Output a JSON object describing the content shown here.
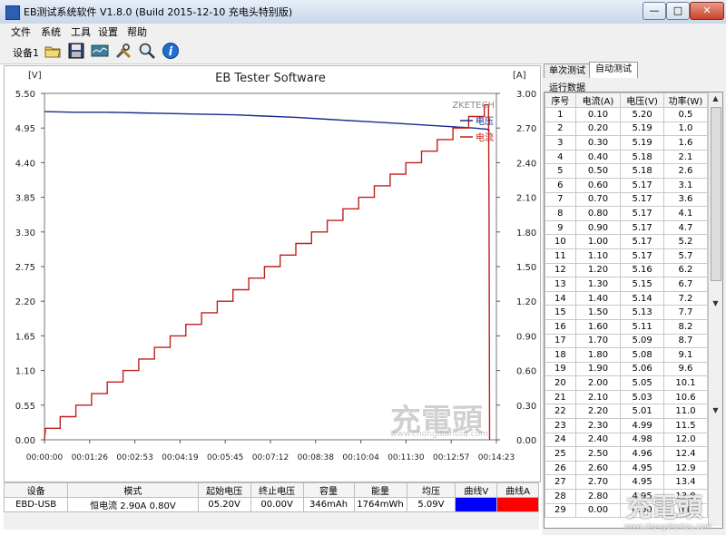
{
  "window": {
    "title": "EB测试系统软件 V1.8.0 (Build 2015-12-10 充电头特别版)",
    "minimize": "—",
    "maximize": "□",
    "close": "✕"
  },
  "menu": [
    "文件",
    "系统",
    "工具",
    "设置",
    "帮助"
  ],
  "toolbar": {
    "device_label": "设备1",
    "icons": [
      "open-folder-icon",
      "save-disk-icon",
      "waveform-icon",
      "tools-icon",
      "zoom-icon",
      "info-icon"
    ]
  },
  "chart_data": {
    "type": "line",
    "title": "EB Tester Software",
    "brand": "ZKETECH",
    "left_unit": "[V]",
    "right_unit": "[A]",
    "y_left_ticks": [
      "5.50",
      "4.95",
      "4.40",
      "3.85",
      "3.30",
      "2.75",
      "2.20",
      "1.65",
      "1.10",
      "0.55",
      "0.00"
    ],
    "y_right_ticks": [
      "3.00",
      "2.70",
      "2.40",
      "2.10",
      "1.80",
      "1.50",
      "1.20",
      "0.90",
      "0.60",
      "0.30",
      "0.00"
    ],
    "x_ticks": [
      "00:00:00",
      "00:01:26",
      "00:02:53",
      "00:04:19",
      "00:05:45",
      "00:07:12",
      "00:08:38",
      "00:10:04",
      "00:11:30",
      "00:12:57",
      "00:14:23"
    ],
    "ylim_left": [
      0,
      5.5
    ],
    "ylim_right": [
      0,
      3.0
    ],
    "x_range_seconds": [
      0,
      863
    ],
    "grid": true,
    "legend": "top-right",
    "series": [
      {
        "name": "电压",
        "axis": "left",
        "color": "#1a2a8c",
        "points": [
          [
            0,
            5.21
          ],
          [
            60,
            5.2
          ],
          [
            120,
            5.2
          ],
          [
            180,
            5.19
          ],
          [
            240,
            5.18
          ],
          [
            300,
            5.17
          ],
          [
            360,
            5.16
          ],
          [
            420,
            5.14
          ],
          [
            480,
            5.12
          ],
          [
            540,
            5.09
          ],
          [
            600,
            5.06
          ],
          [
            660,
            5.03
          ],
          [
            720,
            5.0
          ],
          [
            780,
            4.97
          ],
          [
            820,
            4.95
          ],
          [
            846,
            4.93
          ],
          [
            850,
            4.9
          ]
        ]
      },
      {
        "name": "电流",
        "axis": "right",
        "color": "#c0201a",
        "points": [
          [
            0,
            0.0
          ],
          [
            2,
            0.1
          ],
          [
            30,
            0.1
          ],
          [
            30,
            0.2
          ],
          [
            60,
            0.2
          ],
          [
            60,
            0.3
          ],
          [
            90,
            0.3
          ],
          [
            90,
            0.4
          ],
          [
            120,
            0.4
          ],
          [
            120,
            0.5
          ],
          [
            150,
            0.5
          ],
          [
            150,
            0.6
          ],
          [
            180,
            0.6
          ],
          [
            180,
            0.7
          ],
          [
            210,
            0.7
          ],
          [
            210,
            0.8
          ],
          [
            240,
            0.8
          ],
          [
            240,
            0.9
          ],
          [
            270,
            0.9
          ],
          [
            270,
            1.0
          ],
          [
            300,
            1.0
          ],
          [
            300,
            1.1
          ],
          [
            330,
            1.1
          ],
          [
            330,
            1.2
          ],
          [
            360,
            1.2
          ],
          [
            360,
            1.3
          ],
          [
            390,
            1.3
          ],
          [
            390,
            1.4
          ],
          [
            420,
            1.4
          ],
          [
            420,
            1.5
          ],
          [
            450,
            1.5
          ],
          [
            450,
            1.6
          ],
          [
            480,
            1.6
          ],
          [
            480,
            1.7
          ],
          [
            510,
            1.7
          ],
          [
            510,
            1.8
          ],
          [
            540,
            1.8
          ],
          [
            540,
            1.9
          ],
          [
            570,
            1.9
          ],
          [
            570,
            2.0
          ],
          [
            600,
            2.0
          ],
          [
            600,
            2.1
          ],
          [
            630,
            2.1
          ],
          [
            630,
            2.2
          ],
          [
            660,
            2.2
          ],
          [
            660,
            2.3
          ],
          [
            690,
            2.3
          ],
          [
            690,
            2.4
          ],
          [
            720,
            2.4
          ],
          [
            720,
            2.5
          ],
          [
            750,
            2.5
          ],
          [
            750,
            2.6
          ],
          [
            780,
            2.6
          ],
          [
            780,
            2.7
          ],
          [
            810,
            2.7
          ],
          [
            810,
            2.8
          ],
          [
            840,
            2.8
          ],
          [
            840,
            2.9
          ],
          [
            848,
            2.9
          ],
          [
            849,
            2.0
          ],
          [
            850,
            0.0
          ]
        ]
      }
    ]
  },
  "right_panel": {
    "tabs": [
      "单次测试",
      "自动测试"
    ],
    "active_tab": 1,
    "group_label": "运行数据",
    "columns": [
      "序号",
      "电流(A)",
      "电压(V)",
      "功率(W)"
    ],
    "rows": [
      [
        "1",
        "0.10",
        "5.20",
        "0.5"
      ],
      [
        "2",
        "0.20",
        "5.19",
        "1.0"
      ],
      [
        "3",
        "0.30",
        "5.19",
        "1.6"
      ],
      [
        "4",
        "0.40",
        "5.18",
        "2.1"
      ],
      [
        "5",
        "0.50",
        "5.18",
        "2.6"
      ],
      [
        "6",
        "0.60",
        "5.17",
        "3.1"
      ],
      [
        "7",
        "0.70",
        "5.17",
        "3.6"
      ],
      [
        "8",
        "0.80",
        "5.17",
        "4.1"
      ],
      [
        "9",
        "0.90",
        "5.17",
        "4.7"
      ],
      [
        "10",
        "1.00",
        "5.17",
        "5.2"
      ],
      [
        "11",
        "1.10",
        "5.17",
        "5.7"
      ],
      [
        "12",
        "1.20",
        "5.16",
        "6.2"
      ],
      [
        "13",
        "1.30",
        "5.15",
        "6.7"
      ],
      [
        "14",
        "1.40",
        "5.14",
        "7.2"
      ],
      [
        "15",
        "1.50",
        "5.13",
        "7.7"
      ],
      [
        "16",
        "1.60",
        "5.11",
        "8.2"
      ],
      [
        "17",
        "1.70",
        "5.09",
        "8.7"
      ],
      [
        "18",
        "1.80",
        "5.08",
        "9.1"
      ],
      [
        "19",
        "1.90",
        "5.06",
        "9.6"
      ],
      [
        "20",
        "2.00",
        "5.05",
        "10.1"
      ],
      [
        "21",
        "2.10",
        "5.03",
        "10.6"
      ],
      [
        "22",
        "2.20",
        "5.01",
        "11.0"
      ],
      [
        "23",
        "2.30",
        "4.99",
        "11.5"
      ],
      [
        "24",
        "2.40",
        "4.98",
        "12.0"
      ],
      [
        "25",
        "2.50",
        "4.96",
        "12.4"
      ],
      [
        "26",
        "2.60",
        "4.95",
        "12.9"
      ],
      [
        "27",
        "2.70",
        "4.95",
        "13.4"
      ],
      [
        "28",
        "2.80",
        "4.95",
        "13.8"
      ],
      [
        "29",
        "0.00",
        "0.00",
        "0.0"
      ]
    ]
  },
  "bottom_table": {
    "headers": [
      "设备",
      "模式",
      "起始电压",
      "终止电压",
      "容量",
      "能量",
      "均压",
      "曲线V",
      "曲线A"
    ],
    "row": [
      "EBD-USB",
      "恒电流 2.90A 0.80V",
      "05.20V",
      "00.00V",
      "346mAh",
      "1764mWh",
      "5.09V",
      "",
      ""
    ],
    "curve_v_color": "#0000ff",
    "curve_a_color": "#ff0000"
  },
  "watermarks": [
    "充電頭",
    "www.chongdiantou.com"
  ]
}
